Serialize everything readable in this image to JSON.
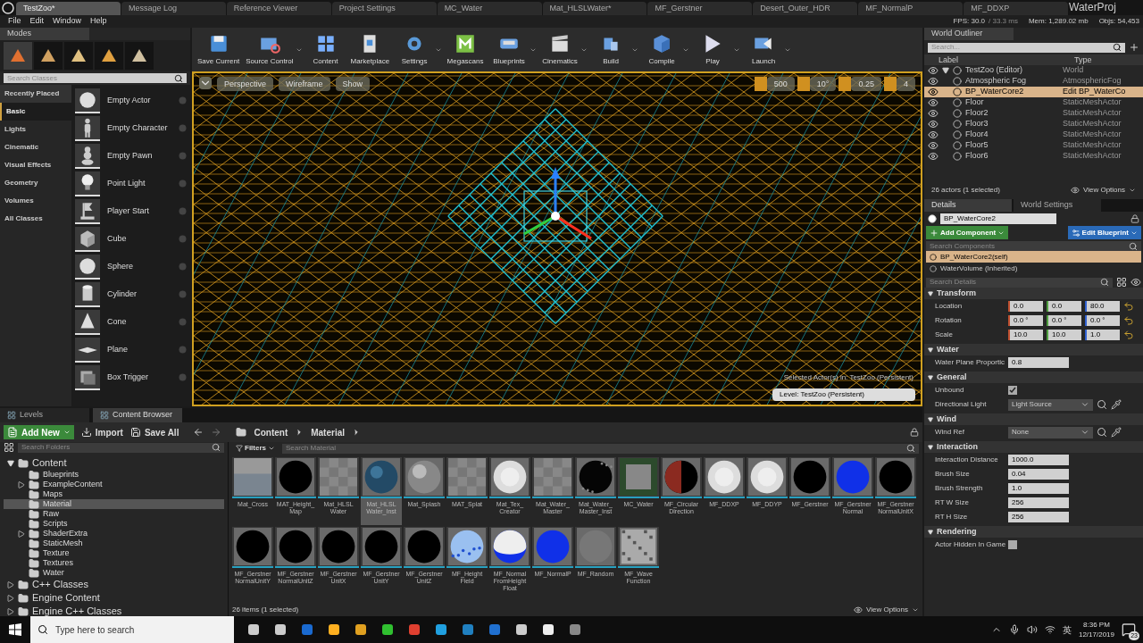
{
  "doc_tabs": [
    {
      "label": "TestZoo*",
      "selected": true
    },
    {
      "label": "Message Log",
      "selected": false
    },
    {
      "label": "Reference Viewer",
      "selected": false
    },
    {
      "label": "Project Settings",
      "selected": false
    },
    {
      "label": "MC_Water",
      "selected": false
    },
    {
      "label": "Mat_HLSLWater*",
      "selected": false
    },
    {
      "label": "MF_Gerstner",
      "selected": false
    },
    {
      "label": "Desert_Outer_HDR",
      "selected": false
    },
    {
      "label": "MF_NormalP",
      "selected": false
    },
    {
      "label": "MF_DDXP",
      "selected": false
    }
  ],
  "project_name": "WaterProj",
  "menu": [
    "File",
    "Edit",
    "Window",
    "Help"
  ],
  "stats": {
    "fps": "FPS: 30.0",
    "ms": "/ 33.3 ms",
    "mem": "Mem: 1,289.02 mb",
    "objs": "Objs: 54,453"
  },
  "modes": {
    "title": "Modes",
    "search_placeholder": "Search Classes",
    "categories": [
      {
        "label": "Recently Placed",
        "selected": false
      },
      {
        "label": "Basic",
        "selected": true
      },
      {
        "label": "Lights",
        "selected": false
      },
      {
        "label": "Cinematic",
        "selected": false
      },
      {
        "label": "Visual Effects",
        "selected": false
      },
      {
        "label": "Geometry",
        "selected": false
      },
      {
        "label": "Volumes",
        "selected": false
      },
      {
        "label": "All Classes",
        "selected": false
      }
    ],
    "items": [
      {
        "label": "Empty Actor",
        "kind": "sphere"
      },
      {
        "label": "Empty Character",
        "kind": "figure"
      },
      {
        "label": "Empty Pawn",
        "kind": "pawn"
      },
      {
        "label": "Point Light",
        "kind": "bulb"
      },
      {
        "label": "Player Start",
        "kind": "flag"
      },
      {
        "label": "Cube",
        "kind": "cube"
      },
      {
        "label": "Sphere",
        "kind": "sphere"
      },
      {
        "label": "Cylinder",
        "kind": "cylinder"
      },
      {
        "label": "Cone",
        "kind": "cone"
      },
      {
        "label": "Plane",
        "kind": "plane"
      },
      {
        "label": "Box Trigger",
        "kind": "box"
      }
    ]
  },
  "toolbar": [
    {
      "label": "Save Current",
      "kind": "save",
      "menu": false
    },
    {
      "label": "Source Control",
      "kind": "source",
      "menu": true
    },
    {
      "label": "Content",
      "kind": "content",
      "menu": false
    },
    {
      "label": "Marketplace",
      "kind": "market",
      "menu": false
    },
    {
      "label": "Settings",
      "kind": "settings",
      "menu": true
    },
    {
      "label": "Megascans",
      "kind": "mega",
      "menu": false
    },
    {
      "label": "Blueprints",
      "kind": "blueprint",
      "menu": true
    },
    {
      "label": "Cinematics",
      "kind": "cinema",
      "menu": true
    },
    {
      "label": "Build",
      "kind": "build",
      "menu": true
    },
    {
      "label": "Compile",
      "kind": "compile",
      "menu": true
    },
    {
      "label": "Play",
      "kind": "play",
      "menu": true
    },
    {
      "label": "Launch",
      "kind": "launch",
      "menu": true
    }
  ],
  "viewport": {
    "view_buttons": [
      "Perspective",
      "Wireframe",
      "Show"
    ],
    "snap_values": [
      "500",
      "10°",
      "0.25",
      "4"
    ],
    "selected_text": "Selected Actor(s) in:  TestZoo (Persistent)",
    "level_text": "Level:  TestZoo (Persistent)"
  },
  "outliner": {
    "title": "World Outliner",
    "search_placeholder": "Search...",
    "columns": [
      "Label",
      "Type"
    ],
    "rows": [
      {
        "label": "TestZoo (Editor)",
        "type": "World",
        "selected": false,
        "expanded": true,
        "children": [
          {
            "label": "Atmospheric Fog",
            "type": "AtmosphericFog",
            "selected": false
          },
          {
            "label": "BP_WaterCore2",
            "type": "Edit BP_WaterCo",
            "selected": true
          },
          {
            "label": "Floor",
            "type": "StaticMeshActor",
            "selected": false
          },
          {
            "label": "Floor2",
            "type": "StaticMeshActor",
            "selected": false
          },
          {
            "label": "Floor3",
            "type": "StaticMeshActor",
            "selected": false
          },
          {
            "label": "Floor4",
            "type": "StaticMeshActor",
            "selected": false
          },
          {
            "label": "Floor5",
            "type": "StaticMeshActor",
            "selected": false
          },
          {
            "label": "Floor6",
            "type": "StaticMeshActor",
            "selected": false
          }
        ]
      }
    ],
    "count": "26 actors (1 selected)",
    "view_options": "View Options"
  },
  "details": {
    "tabs": [
      {
        "label": "Details",
        "selected": true
      },
      {
        "label": "World Settings",
        "selected": false
      }
    ],
    "name": "BP_WaterCore2",
    "add_component": "Add Component",
    "edit_blueprint": "Edit Blueprint",
    "search_components": "Search Components",
    "components": [
      {
        "label": "BP_WaterCore2(self)",
        "selected": true
      },
      {
        "label": "WaterVolume (Inherited)",
        "selected": false
      }
    ],
    "search_details": "Search Details",
    "sections": [
      {
        "title": "Transform",
        "props": [
          {
            "label": "Location",
            "kind": "vector",
            "values": [
              "0.0",
              "0.0",
              "80.0"
            ]
          },
          {
            "label": "Rotation",
            "kind": "vector",
            "values": [
              "0.0 °",
              "0.0 °",
              "0.0 °"
            ]
          },
          {
            "label": "Scale",
            "kind": "vector",
            "values": [
              "10.0",
              "10.0",
              "1.0"
            ]
          }
        ]
      },
      {
        "title": "Water",
        "props": [
          {
            "label": "Water Plane Proportic",
            "kind": "number",
            "value": "0.8"
          }
        ]
      },
      {
        "title": "General",
        "props": [
          {
            "label": "Unbound",
            "kind": "checkbox",
            "checked": true
          },
          {
            "label": "Directional Light",
            "kind": "dropdown",
            "value": "Light Source"
          }
        ]
      },
      {
        "title": "Wind",
        "props": [
          {
            "label": "Wind Ref",
            "kind": "dropdown",
            "value": "None"
          }
        ]
      },
      {
        "title": "Interaction",
        "props": [
          {
            "label": "Interaction Distance",
            "kind": "number",
            "value": "1000.0"
          },
          {
            "label": "Brush Size",
            "kind": "number",
            "value": "0.04"
          },
          {
            "label": "Brush Strength",
            "kind": "number",
            "value": "1.0"
          },
          {
            "label": "RT W Size",
            "kind": "number",
            "value": "256"
          },
          {
            "label": "RT H Size",
            "kind": "number",
            "value": "256"
          }
        ]
      },
      {
        "title": "Rendering",
        "props": [
          {
            "label": "Actor Hidden In Game",
            "kind": "checkbox",
            "checked": false
          }
        ]
      }
    ]
  },
  "bottom_tabs": [
    {
      "label": "Levels",
      "selected": false
    },
    {
      "label": "Content Browser",
      "selected": true
    }
  ],
  "content": {
    "add_new": "Add New",
    "import": "Import",
    "save_all": "Save All",
    "path": [
      "Content",
      "Material"
    ],
    "search_folders": "Search Folders",
    "filters": "Filters",
    "search_assets": "Search Material",
    "folders": [
      {
        "label": "Content",
        "kind": "branch",
        "expanded": true,
        "children": [
          {
            "label": "Blueprints",
            "kind": "leaf",
            "selected": false
          },
          {
            "label": "ExampleContent",
            "kind": "branch",
            "expanded": false,
            "selected": false
          },
          {
            "label": "Maps",
            "kind": "leaf",
            "selected": false
          },
          {
            "label": "Material",
            "kind": "leaf",
            "selected": true
          },
          {
            "label": "Raw",
            "kind": "leaf",
            "selected": false
          },
          {
            "label": "Scripts",
            "kind": "leaf",
            "selected": false
          },
          {
            "label": "ShaderExtra",
            "kind": "branch",
            "expanded": false,
            "selected": false
          },
          {
            "label": "StaticMesh",
            "kind": "leaf",
            "selected": false
          },
          {
            "label": "Texture",
            "kind": "leaf",
            "selected": false
          },
          {
            "label": "Textures",
            "kind": "leaf",
            "selected": false
          },
          {
            "label": "Water",
            "kind": "leaf",
            "selected": false
          }
        ]
      },
      {
        "label": "C++ Classes",
        "kind": "branch",
        "expanded": false
      },
      {
        "label": "Engine Content",
        "kind": "branch",
        "expanded": false
      },
      {
        "label": "Engine C++ Classes",
        "kind": "branch",
        "expanded": false
      }
    ],
    "assets": [
      {
        "label": "Mat_Cross",
        "kind": "gray",
        "selected": false
      },
      {
        "label": "MAT_Height_\nMap",
        "kind": "black",
        "selected": false
      },
      {
        "label": "Mat_HLSL\nWater",
        "kind": "checker",
        "selected": false
      },
      {
        "label": "Mat_HLSL\nWater_Inst",
        "kind": "globe",
        "selected": true
      },
      {
        "label": "Mat_Splash",
        "kind": "sphere",
        "selected": false
      },
      {
        "label": "MAT_Splat",
        "kind": "checker",
        "selected": false
      },
      {
        "label": "Mat_Tex_\nCreator",
        "kind": "white",
        "selected": false
      },
      {
        "label": "Mat_Water_\nMaster",
        "kind": "checker",
        "selected": false
      },
      {
        "label": "Mat_Water_\nMaster_Inst",
        "kind": "speckle",
        "selected": false
      },
      {
        "label": "MC_Water",
        "kind": "xy",
        "selected": false
      },
      {
        "label": "MF_Circular\nDirection",
        "kind": "split",
        "selected": false
      },
      {
        "label": "MF_DDXP",
        "kind": "white",
        "selected": false
      },
      {
        "label": "MF_DDYP",
        "kind": "white",
        "selected": false
      },
      {
        "label": "MF_Gerstner",
        "kind": "black",
        "selected": false
      },
      {
        "label": "MF_Gerstner\nNormal",
        "kind": "blue",
        "selected": false
      },
      {
        "label": "MF_Gerstner\nNormalUnitX",
        "kind": "black",
        "selected": false
      },
      {
        "label": "MF_Gerstner\nNormalUnitY",
        "kind": "black",
        "selected": false
      },
      {
        "label": "MF_Gerstner\nNormalUnitZ",
        "kind": "black",
        "selected": false
      },
      {
        "label": "MF_Gerstner\nUnitX",
        "kind": "black",
        "selected": false
      },
      {
        "label": "MF_Gerstner\nUnitY",
        "kind": "black",
        "selected": false
      },
      {
        "label": "MF_Gerstner\nUnitZ",
        "kind": "black",
        "selected": false
      },
      {
        "label": "MF_Height\nField",
        "kind": "speckleblue",
        "selected": false
      },
      {
        "label": "MF_Normal\nFromHeight\nFloat",
        "kind": "half",
        "selected": false
      },
      {
        "label": "MF_NormalP",
        "kind": "blue",
        "selected": false
      },
      {
        "label": "MF_Random",
        "kind": "gray2",
        "selected": false
      },
      {
        "label": "MF_Wave\nFunction",
        "kind": "noise",
        "selected": false
      }
    ],
    "count": "26 items (1 selected)",
    "view_options": "View Options"
  },
  "taskbar": {
    "search_placeholder": "Type here to search",
    "ime": "英",
    "time": "8:36 PM",
    "date": "12/17/2019",
    "notifications": "23"
  }
}
